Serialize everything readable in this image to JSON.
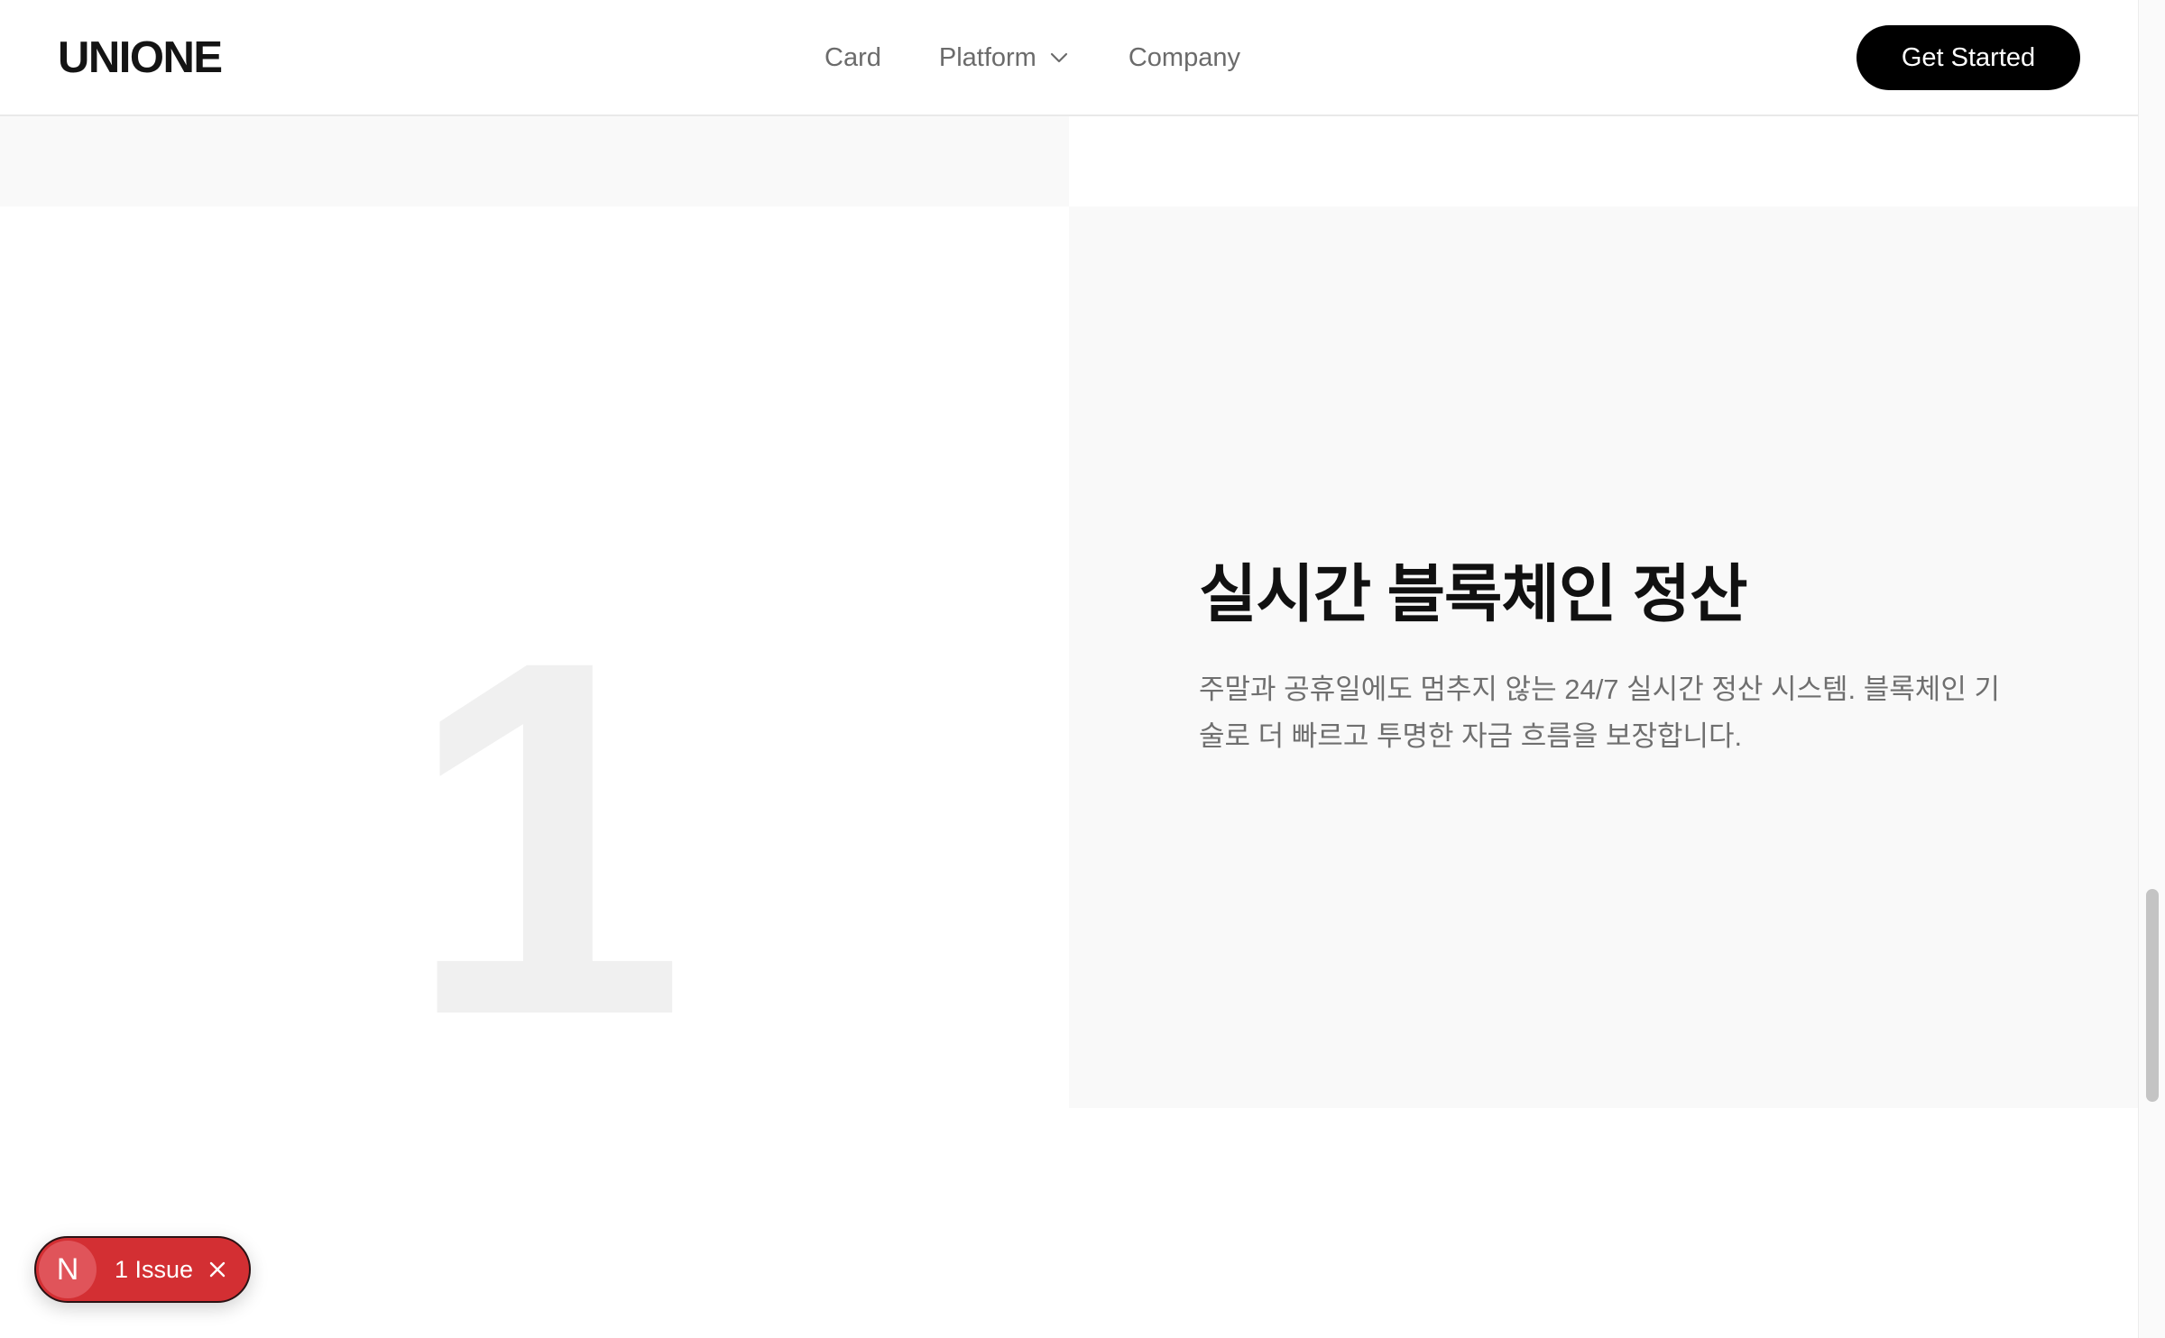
{
  "header": {
    "logo": "UNIONE",
    "nav": {
      "card": "Card",
      "platform": "Platform",
      "company": "Company"
    },
    "cta_label": "Get Started"
  },
  "feature": {
    "number": "1",
    "title": "실시간 블록체인 정산",
    "description": "주말과 공휴일에도 멈추지 않는 24/7 실시간 정산 시스템. 블록체인 기술로 더 빠르고 투명한 자금 흐름을 보장합니다."
  },
  "issue_badge": {
    "avatar_letter": "N",
    "label": "1 Issue"
  },
  "icons": {
    "platform_dropdown": "chevron-down-icon",
    "issue_close": "close-icon"
  },
  "colors": {
    "accent": "#000000",
    "issue_badge": "#d32f33",
    "panel_grey": "#f9f9f9",
    "number_color": "#f0f0f0"
  }
}
